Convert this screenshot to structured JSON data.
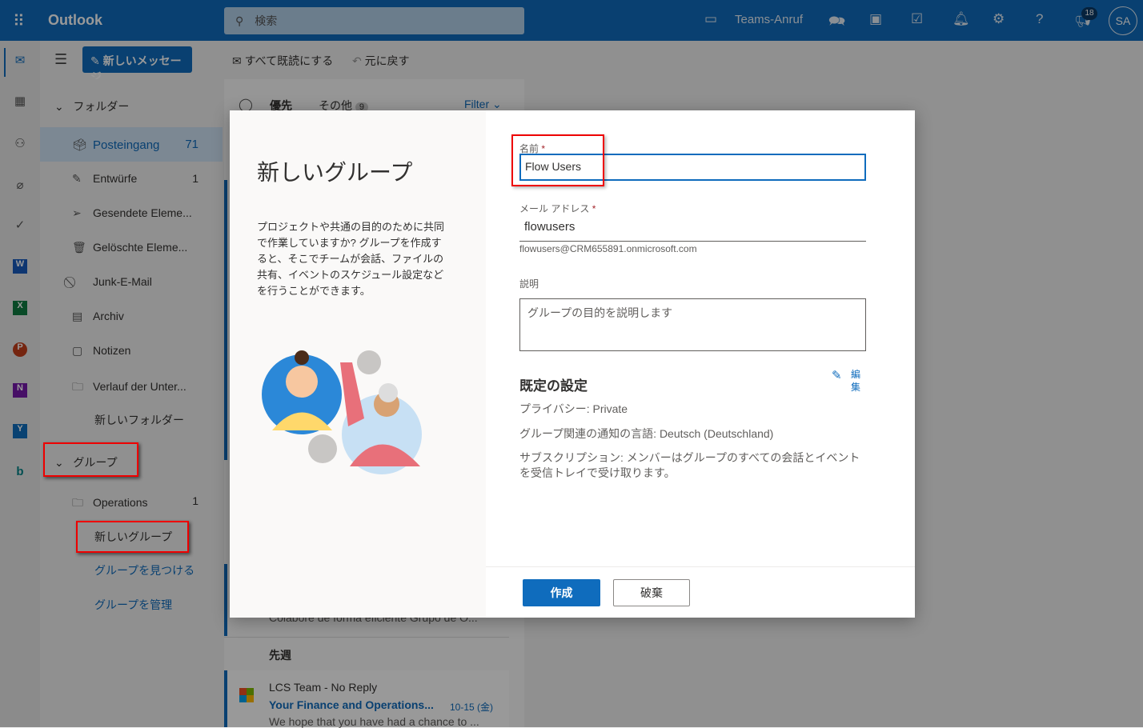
{
  "header": {
    "app": "Outlook",
    "search_placeholder": "検索",
    "teams_call": "Teams-Anruf",
    "notification_count": "18",
    "avatar": "SA",
    "icons": [
      "waffle-icon",
      "search-icon",
      "video-icon",
      "chat-icon",
      "onenote-icon",
      "calendar-check-icon",
      "bell-icon",
      "gear-icon",
      "help-icon",
      "megaphone-icon"
    ]
  },
  "toolbar": {
    "new_message": "新しいメッセージ",
    "mark_all_read": "すべて既読にする",
    "undo": "元に戻す"
  },
  "folders": {
    "header": "フォルダー",
    "items": [
      {
        "label": "Posteingang",
        "count": "71",
        "icon": "inbox-icon",
        "selected": true
      },
      {
        "label": "Entwürfe",
        "count": "1",
        "icon": "pencil-icon"
      },
      {
        "label": "Gesendete Eleme...",
        "count": "",
        "icon": "send-icon"
      },
      {
        "label": "Gelöschte Eleme...",
        "count": "",
        "icon": "trash-icon"
      },
      {
        "label": "Junk-E-Mail",
        "count": "",
        "icon": "block-icon"
      },
      {
        "label": "Archiv",
        "count": "",
        "icon": "archive-icon"
      },
      {
        "label": "Notizen",
        "count": "",
        "icon": "note-icon"
      },
      {
        "label": "Verlauf der Unter...",
        "count": "",
        "icon": "folder-icon"
      }
    ],
    "new_folder": "新しいフォルダー"
  },
  "groups": {
    "header": "グループ",
    "items": [
      {
        "label": "Operations",
        "count": "1"
      }
    ],
    "new_group": "新しいグループ",
    "find_groups": "グループを見つける",
    "manage_groups": "グループを管理"
  },
  "message_list": {
    "tab_focused": "優先",
    "tab_other": "その他",
    "other_count": "9",
    "filter": "Filter",
    "partial_preview": "Colabore de forma eficiente Grupo de O...",
    "section": "先週",
    "items": [
      {
        "sender": "LCS Team - No Reply",
        "subject": "Your Finance and Operations...",
        "date": "10-15 (金)",
        "preview": "We hope that you have had a chance to ..."
      }
    ]
  },
  "dialog": {
    "title": "新しいグループ",
    "description": "プロジェクトや共通の目的のために共同で作業していますか? グループを作成すると、そこでチームが会話、ファイルの共有、イベントのスケジュール設定などを行うことができます。",
    "name_label": "名前",
    "name_value": "Flow Users",
    "email_label": "メール アドレス",
    "email_value": "flowusers",
    "email_full": "flowusers@CRM655891.onmicrosoft.com",
    "desc_label": "説明",
    "desc_placeholder": "グループの目的を説明します",
    "settings_title": "既定の設定",
    "edit": "編集",
    "privacy": "プライバシー: Private",
    "language": "グループ関連の通知の言語: Deutsch (Deutschland)",
    "subscription": "サブスクリプション: メンバーはグループのすべての会話とイベントを受信トレイで受け取ります。",
    "create": "作成",
    "discard": "破棄",
    "required_mark": "*"
  }
}
